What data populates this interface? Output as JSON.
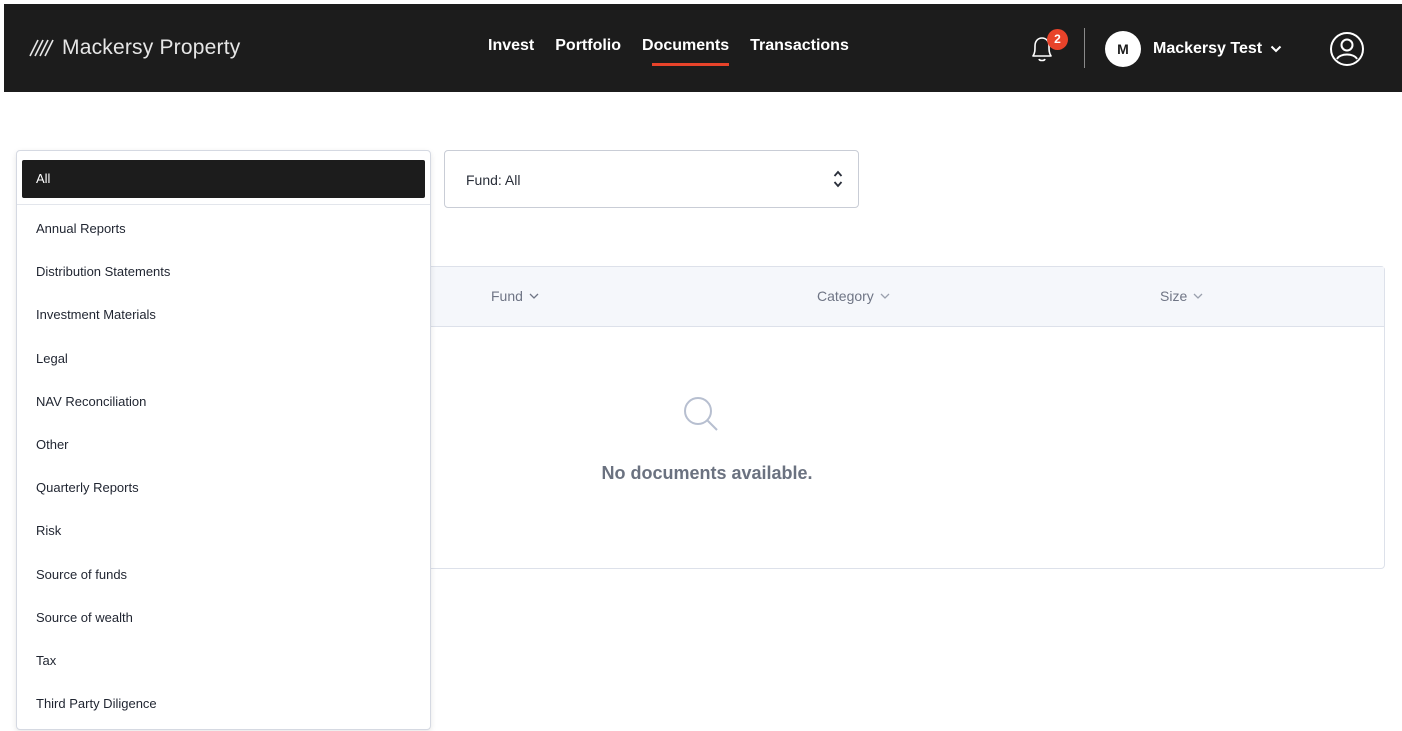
{
  "header": {
    "brand_name": "Mackersy Property",
    "nav": [
      {
        "label": "Invest",
        "active": false
      },
      {
        "label": "Portfolio",
        "active": false
      },
      {
        "label": "Documents",
        "active": true
      },
      {
        "label": "Transactions",
        "active": false
      }
    ],
    "notification_count": "2",
    "user": {
      "initial": "M",
      "name": "Mackersy Test"
    },
    "icons": [
      "bell-icon",
      "chevron-down-icon",
      "user-circle-icon"
    ]
  },
  "filters": {
    "category": {
      "selected": "All",
      "options": [
        "Annual Reports",
        "Distribution Statements",
        "Investment Materials",
        "Legal",
        "NAV Reconciliation",
        "Other",
        "Quarterly Reports",
        "Risk",
        "Source of funds",
        "Source of wealth",
        "Tax",
        "Third Party Diligence"
      ]
    },
    "fund": {
      "value": "Fund: All"
    }
  },
  "table": {
    "columns": [
      "Fund",
      "Category",
      "Size"
    ],
    "empty_message": "No documents available."
  },
  "colors": {
    "header_bg": "#1c1c1c",
    "accent": "#e8432a",
    "table_header_bg": "#f5f7fb"
  }
}
